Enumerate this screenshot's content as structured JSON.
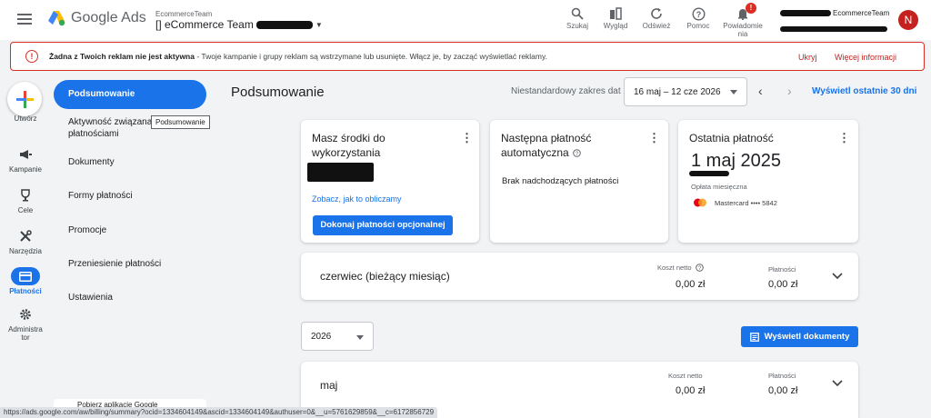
{
  "header": {
    "app_name": "Google Ads",
    "account_top": "EcommerceTeam",
    "account_name": "[] eCommerce Team",
    "tools": [
      {
        "icon": "search-icon",
        "label": "Szukaj"
      },
      {
        "icon": "appearance-icon",
        "label": "Wygląd"
      },
      {
        "icon": "refresh-icon",
        "label": "Odśwież"
      },
      {
        "icon": "help-icon",
        "label": "Pomoc"
      },
      {
        "icon": "bell-icon",
        "label": "Powiadomienia",
        "label_line1": "Powiadomie",
        "label_line2": "nia",
        "badge": "!"
      }
    ],
    "user_org": "EcommerceTeam",
    "avatar_letter": "N"
  },
  "alert": {
    "bold": "Żadna z Twoich reklam nie jest aktywna",
    "text": " - Twoje kampanie i grupy reklam są wstrzymane lub usunięte. Włącz je, by zacząć wyświetlać reklamy.",
    "hide": "Ukryj",
    "more": "Więcej informacji"
  },
  "leftnav": {
    "create": "Utwórz",
    "items": [
      {
        "icon": "campaigns-icon",
        "label": "Kampanie"
      },
      {
        "icon": "trophy-icon",
        "label": "Cele"
      },
      {
        "icon": "tools-icon",
        "label": "Narzędzia"
      },
      {
        "icon": "payment-card-icon",
        "label": "Płatności",
        "active": true
      },
      {
        "icon": "gear-icon",
        "label": "Administrator",
        "label_line1": "Administra",
        "label_line2": "tor"
      }
    ]
  },
  "subnav": {
    "items": [
      "Podsumowanie",
      "Aktywność związana z płatnościami",
      "Dokumenty",
      "Formy płatności",
      "Promocje",
      "Przeniesienie płatności",
      "Ustawienia"
    ],
    "item1_line1": "Aktywność związana",
    "item1_line2": "płatnościami",
    "tooltip": "Podsumowanie",
    "app_banner": "Pobierz aplikację Google"
  },
  "main": {
    "title": "Podsumowanie",
    "range_label": "Niestandardowy zakres dat",
    "date_range": "16 maj – 12 cze 2026",
    "show_last": "Wyświetl ostatnie 30 dni",
    "cards": {
      "funds": {
        "title_line1": "Masz środki do",
        "title_line2": "wykorzystania",
        "link": "Zobacz, jak to obliczamy",
        "button": "Dokonaj płatności opcjonalnej"
      },
      "next": {
        "title_line1": "Następna płatność",
        "title_line2": "automatyczna",
        "text": "Brak nadchodzących płatności"
      },
      "last": {
        "title": "Ostatnia płatność",
        "date": "1 maj 2025",
        "fee": "Opłata miesięczna",
        "card": "Mastercard •••• 5842"
      }
    },
    "current_month": {
      "title": "czerwiec (bieżący miesiąc)",
      "net_cost_label": "Koszt netto",
      "net_cost": "0,00 zł",
      "payments_label": "Płatności",
      "payments": "0,00 zł"
    },
    "year": "2026",
    "view_docs": "Wyświetl dokumenty",
    "may": {
      "title": "maj",
      "net_cost_label": "Koszt netto",
      "net_cost": "0,00 zł",
      "payments_label": "Płatności",
      "payments": "0,00 zł"
    }
  },
  "status_url": "https://ads.google.com/aw/billing/summary?ocid=1334604149&ascid=1334604149&authuser=0&__u=5761629859&__c=6172856729"
}
